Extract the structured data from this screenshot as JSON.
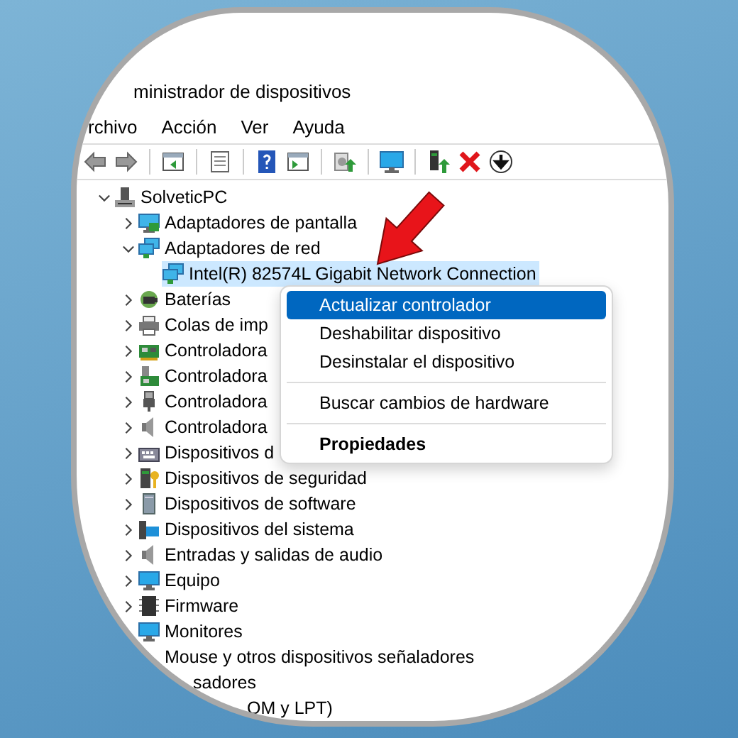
{
  "window": {
    "title": "ministrador de dispositivos"
  },
  "menu_bar": [
    "rchivo",
    "Acción",
    "Ver",
    "Ayuda"
  ],
  "tree": [
    {
      "label": "SolveticPC",
      "kind": "computer",
      "expanded": true,
      "selected": false,
      "children": [
        {
          "label": "Adaptadores de pantalla",
          "kind": "category",
          "expanded": false,
          "selected": false
        },
        {
          "label": "Adaptadores de red",
          "kind": "category",
          "expanded": true,
          "selected": false,
          "children": [
            {
              "label": "Intel(R) 82574L Gigabit Network Connection",
              "kind": "device",
              "selected": true
            }
          ]
        },
        {
          "label": "Baterías",
          "kind": "category",
          "expanded": false,
          "selected": false
        },
        {
          "label": "Colas de imp",
          "kind": "category",
          "expanded": false,
          "selected": false
        },
        {
          "label": "Controladora",
          "kind": "category",
          "expanded": false,
          "selected": false
        },
        {
          "label": "Controladora",
          "kind": "category",
          "expanded": false,
          "selected": false
        },
        {
          "label": "Controladora",
          "kind": "category",
          "expanded": false,
          "selected": false
        },
        {
          "label": "Controladora",
          "kind": "category",
          "expanded": false,
          "selected": false
        },
        {
          "label": "Dispositivos d",
          "kind": "category",
          "expanded": false,
          "selected": false
        },
        {
          "label": "Dispositivos de seguridad",
          "kind": "category",
          "expanded": false,
          "selected": false
        },
        {
          "label": "Dispositivos de software",
          "kind": "category",
          "expanded": false,
          "selected": false
        },
        {
          "label": "Dispositivos del sistema",
          "kind": "category",
          "expanded": false,
          "selected": false
        },
        {
          "label": "Entradas y salidas de audio",
          "kind": "category",
          "expanded": false,
          "selected": false
        },
        {
          "label": "Equipo",
          "kind": "category",
          "expanded": false,
          "selected": false
        },
        {
          "label": "Firmware",
          "kind": "category",
          "expanded": false,
          "selected": false
        },
        {
          "label": "Monitores",
          "kind": "category",
          "selected": false
        },
        {
          "label": "Mouse y otros dispositivos señaladores",
          "kind": "category",
          "selected": false
        },
        {
          "label": "sadores",
          "kind": "partial",
          "selected": false
        },
        {
          "label": "OM y LPT)",
          "kind": "partial",
          "selected": false
        }
      ]
    }
  ],
  "context_menu": [
    {
      "kind": "item",
      "label": "Actualizar controlador",
      "selected": true
    },
    {
      "kind": "item",
      "label": "Deshabilitar dispositivo",
      "selected": false
    },
    {
      "kind": "item",
      "label": "Desinstalar el dispositivo",
      "selected": false
    },
    {
      "kind": "separator"
    },
    {
      "kind": "item",
      "label": "Buscar cambios de hardware",
      "selected": false
    },
    {
      "kind": "separator"
    },
    {
      "kind": "default",
      "label": "Propiedades",
      "selected": false
    }
  ]
}
